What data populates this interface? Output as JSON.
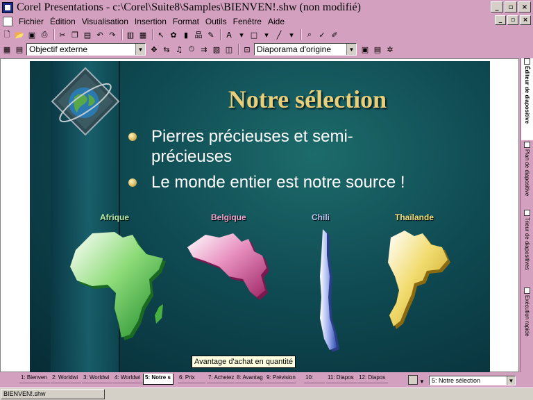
{
  "window": {
    "title": "Corel Presentations - c:\\Corel\\Suite8\\Samples\\BIENVEN!.shw (non modifié)",
    "minimize": "_",
    "restore": "▫",
    "close": "×"
  },
  "menu": {
    "items": [
      "Fichier",
      "Édition",
      "Visualisation",
      "Insertion",
      "Format",
      "Outils",
      "Fenêtre",
      "Aide"
    ]
  },
  "toolbar2": {
    "object_combo": "Objectif externe",
    "show_combo": "Diaporama d'origine"
  },
  "slide": {
    "title": "Notre sélection",
    "bullets": [
      {
        "line1": "Pierres précieuses et semi-",
        "line2": "précieuses"
      },
      {
        "line1": "Le monde entier est notre source !",
        "line2": ""
      }
    ],
    "countries": [
      {
        "name": "Afrique",
        "color": "#b6f0a8"
      },
      {
        "name": "Belgique",
        "color": "#f2a6d0"
      },
      {
        "name": "Chili",
        "color": "#b8c6f4"
      },
      {
        "name": "Thaïlande",
        "color": "#f4e27a"
      }
    ]
  },
  "tooltip": "Avantage d'achat en quantité",
  "side_tabs": [
    "Éditeur de diapositive",
    "Plan de diapositive",
    "Trieur de diapositives",
    "Exécution rapide"
  ],
  "slide_tabs": [
    "1: Bienven",
    "2: Worldwi",
    "3: Worldwi",
    "4: Worldwi",
    "5: Notre s",
    "6: Prix",
    "7: Achetez",
    "8: Avantag",
    "9: Prévision",
    "10:",
    "11: Diapos",
    "12: Diapos"
  ],
  "slide_selector": "5: Notre sélection",
  "taskbar": {
    "button": "BIENVEN!.shw"
  }
}
